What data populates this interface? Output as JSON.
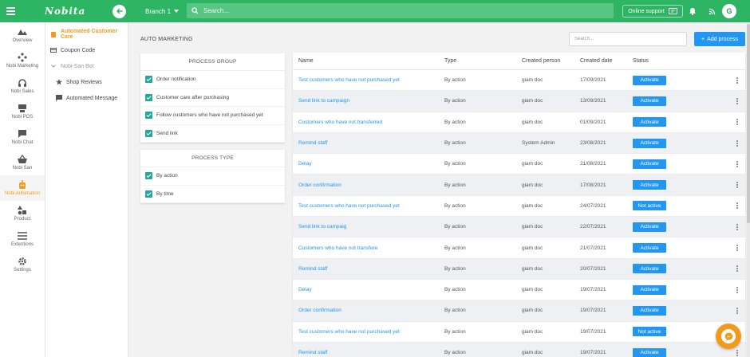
{
  "colors": {
    "brand_green": "#2db563",
    "accent_orange": "#f39a1c",
    "action_blue": "#2196f3",
    "check_teal": "#26a69a"
  },
  "header": {
    "logo": "Nobita",
    "branch": "Branch 1",
    "search_placeholder": "Search...",
    "online_support": "Online support",
    "avatar_initial": "G"
  },
  "leftnav": [
    {
      "label": "Overview",
      "icon": "mountain-icon"
    },
    {
      "label": "Nobi Marketing",
      "icon": "gamepad-icon"
    },
    {
      "label": "Nobi Sales",
      "icon": "headset-icon"
    },
    {
      "label": "Nobi POS",
      "icon": "pos-icon"
    },
    {
      "label": "Nobi Chat",
      "icon": "chat-icon"
    },
    {
      "label": "Nobi San",
      "icon": "basket-icon"
    },
    {
      "label": "Nobi Automation",
      "icon": "robot-icon",
      "active": true
    },
    {
      "label": "Product",
      "icon": "shapes-icon"
    },
    {
      "label": "Extentions",
      "icon": "list-icon"
    },
    {
      "label": "Settings",
      "icon": "gear-icon"
    }
  ],
  "submenu": {
    "automated_customer_care": "Automated Customer Care",
    "coupon_code": "Coupon Code",
    "nobi_san_bot": "Nobi-San Bot",
    "shop_reviews": "Shop Reviews",
    "automated_message": "Automated Message"
  },
  "main": {
    "title": "AUTO MARKETING",
    "search_placeholder": "Search...",
    "add_process": "Add process"
  },
  "process_group": {
    "title": "PROCESS GROUP",
    "items": [
      "Order notification",
      "Customer care after purchasing",
      "Follow customers who have not purchased yet",
      "Send link"
    ]
  },
  "process_type": {
    "title": "PROCESS TYPE",
    "items": [
      "By action",
      "By time"
    ]
  },
  "table": {
    "headers": {
      "name": "Name",
      "type": "Type",
      "person": "Created person",
      "date": "Created date",
      "status": "Status"
    },
    "rows": [
      {
        "name": "Test customers who have not purchased yet",
        "type": "By action",
        "person": "giam doc",
        "date": "17/09/2021",
        "status": "Activate"
      },
      {
        "name": "Send link to campaign",
        "type": "By action",
        "person": "giam doc",
        "date": "13/09/2021",
        "status": "Activate"
      },
      {
        "name": "Customers who have not transferred",
        "type": "By action",
        "person": "giam doc",
        "date": "01/09/2021",
        "status": "Activate"
      },
      {
        "name": "Remind staff",
        "type": "By action",
        "person": "System Admin",
        "date": "23/08/2021",
        "status": "Activate"
      },
      {
        "name": "Delay",
        "type": "By action",
        "person": "giam doc",
        "date": "21/08/2021",
        "status": "Activate"
      },
      {
        "name": "Order confirmation",
        "type": "By action",
        "person": "giam doc",
        "date": "17/08/2021",
        "status": "Activate"
      },
      {
        "name": "Test customers who have not purchased yet",
        "type": "By action",
        "person": "giam doc",
        "date": "24/07/2021",
        "status": "Not active"
      },
      {
        "name": "Send link to campaig",
        "type": "By action",
        "person": "giam doc",
        "date": "22/07/2021",
        "status": "Activate"
      },
      {
        "name": "Customers who have not transfere",
        "type": "By action",
        "person": "giam doc",
        "date": "21/07/2021",
        "status": "Activate"
      },
      {
        "name": "Remind staff",
        "type": "By action",
        "person": "giam doc",
        "date": "20/07/2021",
        "status": "Activate"
      },
      {
        "name": "Delay",
        "type": "By action",
        "person": "giam doc",
        "date": "19/07/2021",
        "status": "Activate"
      },
      {
        "name": "Order confirmation",
        "type": "By action",
        "person": "giam doc",
        "date": "19/07/2021",
        "status": "Activate"
      },
      {
        "name": "Test customers who have not purchased yet",
        "type": "By action",
        "person": "giam doc",
        "date": "19/07/2021",
        "status": "Not active"
      },
      {
        "name": "Remind staff",
        "type": "By action",
        "person": "giam doc",
        "date": "19/07/2021",
        "status": "Activate"
      }
    ]
  }
}
